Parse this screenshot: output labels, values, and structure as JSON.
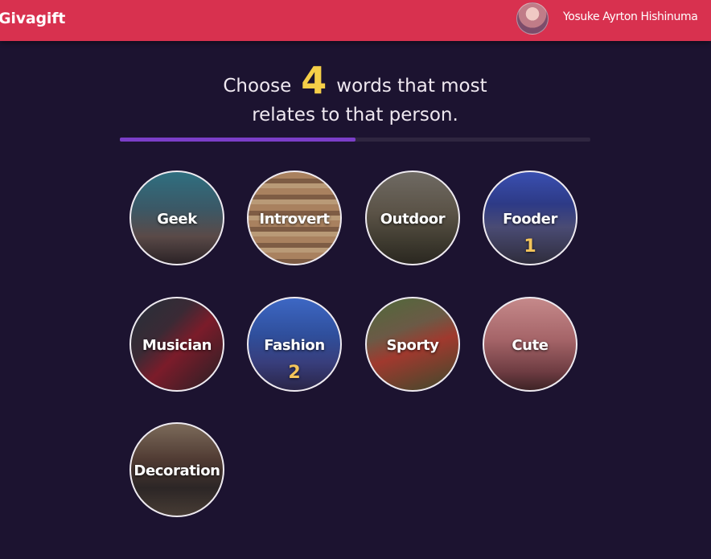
{
  "header": {
    "brand": "Givagift",
    "user_name": "Yosuke Ayrton Hishinuma"
  },
  "prompt": {
    "before": "Choose",
    "count": "4",
    "after": "words that most",
    "line2": "relates to that person."
  },
  "progress": {
    "fraction": 0.5
  },
  "words": [
    {
      "label": "Geek",
      "rank": ""
    },
    {
      "label": "Introvert",
      "rank": ""
    },
    {
      "label": "Outdoor",
      "rank": ""
    },
    {
      "label": "Fooder",
      "rank": "1"
    },
    {
      "label": "Musician",
      "rank": ""
    },
    {
      "label": "Fashion",
      "rank": "2"
    },
    {
      "label": "Sporty",
      "rank": ""
    },
    {
      "label": "Cute",
      "rank": ""
    },
    {
      "label": "Decoration",
      "rank": ""
    }
  ],
  "colors": {
    "header_bg": "#d8314f",
    "page_bg": "#1c1330",
    "accent_number": "#f6cf48",
    "progress_fill": "#7b3ec8",
    "rank_color": "#f4c55a"
  }
}
